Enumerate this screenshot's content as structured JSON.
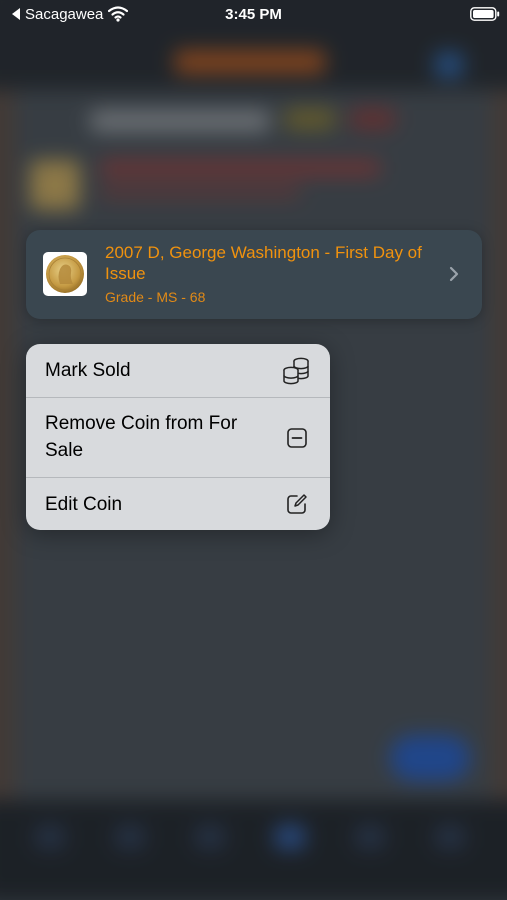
{
  "status_bar": {
    "back_app": "Sacagawea",
    "time": "3:45 PM"
  },
  "preview_card": {
    "title": "2007 D, George Washington - First Day of Issue",
    "grade": "Grade - MS - 68",
    "accent_color": "#f0920e"
  },
  "context_menu": {
    "items": [
      {
        "label": "Mark Sold",
        "icon": "coins-stack-icon"
      },
      {
        "label": "Remove Coin from For Sale",
        "icon": "minus-square-icon"
      },
      {
        "label": "Edit Coin",
        "icon": "edit-square-icon"
      }
    ]
  }
}
